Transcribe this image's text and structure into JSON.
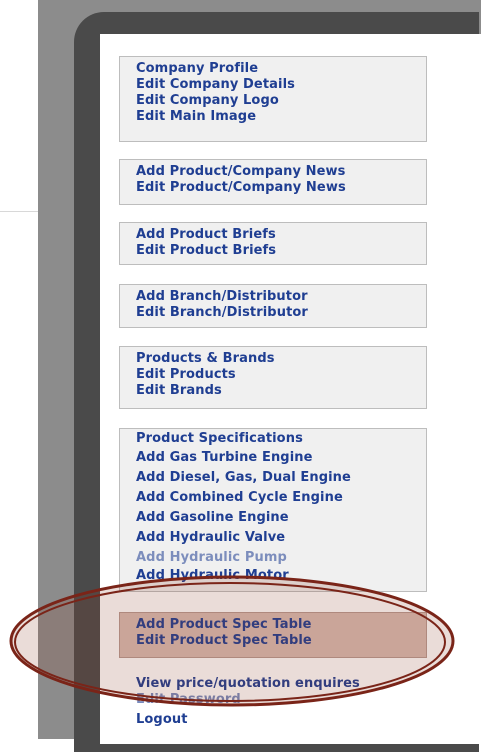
{
  "menu": {
    "groups": [
      {
        "items": [
          "Company Profile",
          "Edit Company Details",
          "Edit Company Logo",
          "Edit Main Image"
        ]
      },
      {
        "items": [
          "Add Product/Company News",
          "Edit Product/Company News"
        ]
      },
      {
        "items": [
          "Add Product Briefs",
          "Edit Product Briefs"
        ]
      },
      {
        "items": [
          "Add Branch/Distributor",
          "Edit Branch/Distributor"
        ]
      },
      {
        "items": [
          "Products & Brands",
          "Edit Products",
          "Edit Brands"
        ]
      },
      {
        "items": [
          "Product Specifications",
          "Add Gas Turbine Engine",
          "Add Diesel, Gas, Dual Engine",
          "Add Combined Cycle Engine",
          "Add Gasoline Engine",
          "Add Hydraulic Valve",
          "Add Hydraulic Pump",
          "Add Hydraulic Motor"
        ]
      },
      {
        "items": [
          "Add Product Spec Table",
          "Edit Product Spec Table"
        ]
      }
    ],
    "footer_links": [
      "View price/quotation enquires",
      "Edit Password",
      "Logout"
    ]
  },
  "colors": {
    "link": "#1f3e92",
    "highlight_ellipse": "#7a2418",
    "highlight_fill": "#c9a79c"
  }
}
